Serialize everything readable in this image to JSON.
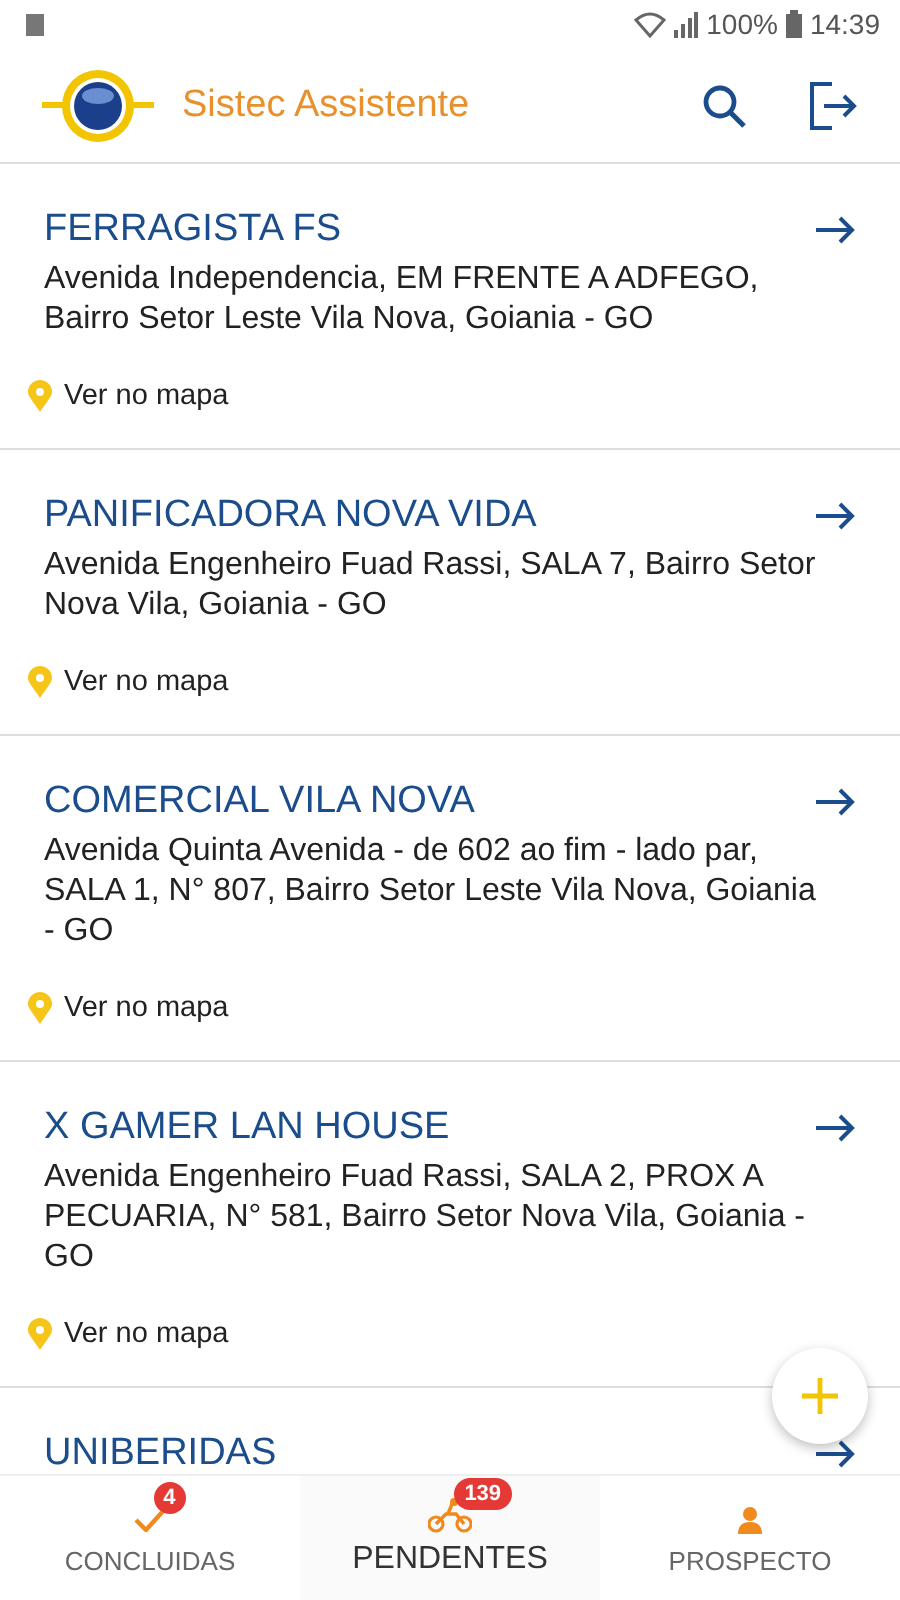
{
  "status_bar": {
    "battery": "100%",
    "time": "14:39"
  },
  "app_bar": {
    "title": "Sistec Assistente"
  },
  "places": [
    {
      "name": "FERRAGISTA FS",
      "address": "Avenida Independencia, EM FRENTE A ADFEGO, Bairro Setor Leste Vila Nova, Goiania - GO",
      "map_link": "Ver no mapa"
    },
    {
      "name": "PANIFICADORA NOVA VIDA",
      "address": "Avenida Engenheiro Fuad Rassi, SALA 7, Bairro Setor Nova Vila, Goiania - GO",
      "map_link": "Ver no mapa"
    },
    {
      "name": "COMERCIAL VILA NOVA",
      "address": "Avenida Quinta Avenida - de 602 ao fim - lado par, SALA 1, N° 807, Bairro Setor Leste Vila Nova, Goiania - GO",
      "map_link": "Ver no mapa"
    },
    {
      "name": "X GAMER LAN HOUSE",
      "address": "Avenida Engenheiro Fuad Rassi, SALA 2, PROX A PECUARIA, N° 581, Bairro Setor Nova Vila, Goiania - GO",
      "map_link": "Ver no mapa"
    },
    {
      "name": "UNIBERIDAS"
    }
  ],
  "bottom_nav": [
    {
      "label": "CONCLUIDAS",
      "badge": "4",
      "selected": false
    },
    {
      "label": "PENDENTES",
      "badge": "139",
      "selected": true
    },
    {
      "label": "PROSPECTO",
      "selected": false
    }
  ]
}
